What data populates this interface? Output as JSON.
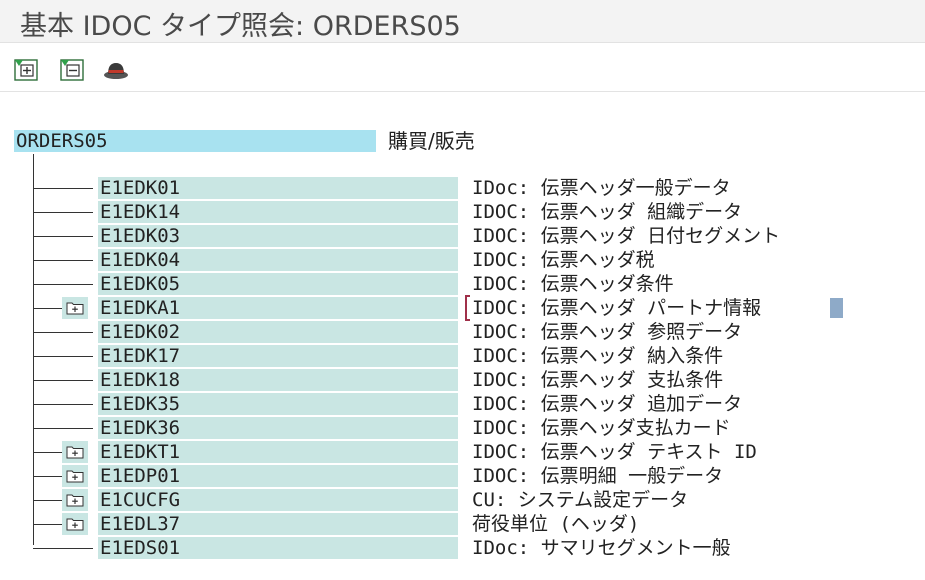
{
  "window": {
    "title": "基本 IDOC タイプ照会: ORDERS05"
  },
  "toolbar": {
    "buttons": [
      {
        "icon": "expand-all-icon"
      },
      {
        "icon": "collapse-all-icon"
      },
      {
        "icon": "hat-icon"
      }
    ]
  },
  "tree": {
    "root": {
      "name": "ORDERS05",
      "description": "購買/販売"
    },
    "segments": [
      {
        "name": "E1EDK01",
        "description": "IDoc: 伝票ヘッダ一般データ",
        "has_children": false
      },
      {
        "name": "E1EDK14",
        "description": "IDOC: 伝票ヘッダ 組織データ",
        "has_children": false
      },
      {
        "name": "E1EDK03",
        "description": "IDOC: 伝票ヘッダ 日付セグメント",
        "has_children": false
      },
      {
        "name": "E1EDK04",
        "description": "IDOC: 伝票ヘッダ税",
        "has_children": false
      },
      {
        "name": "E1EDK05",
        "description": "IDOC: 伝票ヘッダ条件",
        "has_children": false
      },
      {
        "name": "E1EDKA1",
        "description": "IDOC: 伝票ヘッダ パートナ情報",
        "has_children": true,
        "selected": true
      },
      {
        "name": "E1EDK02",
        "description": "IDOC: 伝票ヘッダ 参照データ",
        "has_children": false
      },
      {
        "name": "E1EDK17",
        "description": "IDOC: 伝票ヘッダ 納入条件",
        "has_children": false
      },
      {
        "name": "E1EDK18",
        "description": "IDOC: 伝票ヘッダ 支払条件",
        "has_children": false
      },
      {
        "name": "E1EDK35",
        "description": "IDOC: 伝票ヘッダ 追加データ",
        "has_children": false
      },
      {
        "name": "E1EDK36",
        "description": "IDOC: 伝票ヘッダ支払カード",
        "has_children": false
      },
      {
        "name": "E1EDKT1",
        "description": "IDOC: 伝票ヘッダ テキスト ID",
        "has_children": true
      },
      {
        "name": "E1EDP01",
        "description": "IDOC: 伝票明細 一般データ",
        "has_children": true
      },
      {
        "name": "E1CUCFG",
        "description": "CU: システム設定データ",
        "has_children": true
      },
      {
        "name": "E1EDL37",
        "description": "荷役単位 (ヘッダ)",
        "has_children": true
      },
      {
        "name": "E1EDS01",
        "description": "IDoc: サマリセグメント一般",
        "has_children": false
      }
    ]
  },
  "colors": {
    "root_highlight": "#a8e2f0",
    "segment_background": "#c9e6e3",
    "cursor": "#8eaac8",
    "bracket": "#a0304a"
  }
}
